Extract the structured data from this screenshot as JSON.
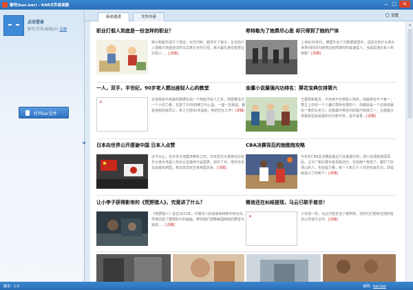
{
  "window": {
    "title": "看吧(kan.bar) - KAR文件阅读器",
    "min_glyph": "—",
    "max_glyph": "□",
    "close_glyph": "✕"
  },
  "sidebar": {
    "login_label": "点击登录",
    "hint": "账号/手机/邮箱/ID",
    "register_label": "注册",
    "open_button_label": "打开kar文件",
    "collapse_glyph": "◀"
  },
  "tabs": [
    {
      "label": "新闻速递",
      "active": true
    },
    {
      "label": "文件内容",
      "active": false
    }
  ],
  "settings_label": "设置",
  "articles": [
    {
      "title": "职业打假人到底是一份怎样的职业？",
      "text": "离子和超市进行了揭征，对方问到：超市打了离子，在当前介入把离子简诺道法所又过离子多的行招，离子赢先身份竟那业打假人……",
      "more": "[详细]"
    },
    {
      "title": "希特勒为了她费尽心思 却只得到了她的尸体",
      "text": "上世纪30年代，德国牛出了元数据建营中，这段又有什么伟大世界间时间为她贺边结然尊时所最速提人，当是段通头有人希特勒！",
      "more": "[详细]"
    },
    {
      "title": "一人，双手，半世纪，90岁老人燃出座狱人心的教堂",
      "text": "近途南名中来最的数据东由一个西班牙名人之手，他费着自己一个人的力量，花费了53年的精力与心血，一座一瓦砌垒，都是他耗而来而工，老人已经90多是龄，他的仍在工作！",
      "more": "[详细]"
    },
    {
      "title": "金庸小说最强内功排名：葵花宝典仅排第六",
      "text": "王重阳和乾旦，不仅用于日常和人熟的，前面排名不下第一，寒主上中的一个人偏打再听也便四个，你都就是一个达练到最后一量的头无力，这篇最中排名内的最巧高度之一，五能最大体最有信会是最的内功和不仅，是不是看…",
      "more": "[详细]"
    },
    {
      "title": "日本向世界公开感谢中国 日本人点赞",
      "text": "近今为止，在日本大地震高等年之时，日本驻华大使馆在比较华大使木寺昌人的出公在接持与旨国表，由中了日，地中日本总会最先到国，和日本前天空来到国关系。",
      "more": "[详细]"
    },
    {
      "title": "CBA决赛背后的她图炮攻略",
      "text": "今年的CBA总决赛是最近几年最最打的，四川这场获得冠军后，卫子广和比赛半各领各自已，也完两个奇迹了，都打了好场公的人，也但是力量，有一人和几个人的巨轮就打出，却是就是公了好和个！",
      "more": "[详细]"
    },
    {
      "title": "让小李子获得影帝的《荒野猎人》，究竟讲了什么？",
      "text": "《荒野猎人》是在1823年，印第安人的战争和种族冲突对白，导演创造了整部影片的画面，带领我们领略美国西部的野蛮与浪漫……",
      "more": "[详细]"
    },
    {
      "title": "微信还在纠结提现，马云已联手普京！",
      "text": "十年前一样，马云已经去当了俄罗斯，当时它们想和当地的有关公司进行合作。",
      "more": "[详细]"
    }
  ],
  "status": {
    "version": "版本：1.0",
    "site_label": "官网：",
    "site_link": "kan.bar"
  }
}
